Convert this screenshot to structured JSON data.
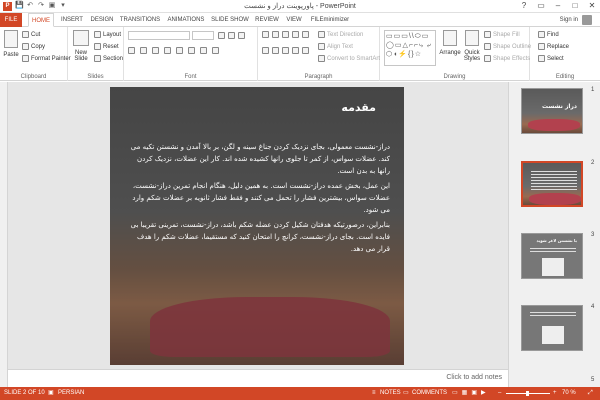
{
  "app": {
    "logo": "P",
    "title": "پاورپوینت دراز و نشست - PowerPoint",
    "window_buttons": [
      "?",
      "▭",
      "–",
      "□",
      "✕"
    ]
  },
  "qat": [
    "💾",
    "↶",
    "↷",
    "▣",
    "▾"
  ],
  "tabs": [
    "FILE",
    "HOME",
    "INSERT",
    "DESIGN",
    "TRANSITIONS",
    "ANIMATIONS",
    "SLIDE SHOW",
    "REVIEW",
    "VIEW",
    "FILEminimizer"
  ],
  "signin": "Sign in",
  "ribbon": {
    "clipboard": {
      "label": "Clipboard",
      "paste": "Paste",
      "cut": "Cut",
      "copy": "Copy",
      "format_painter": "Format Painter"
    },
    "slides": {
      "label": "Slides",
      "new_slide": "New Slide",
      "layout": "Layout",
      "reset": "Reset",
      "section": "Section"
    },
    "font": {
      "label": "Font"
    },
    "paragraph": {
      "label": "Paragraph",
      "text_direction": "Text Direction",
      "align_text": "Align Text",
      "convert_smartart": "Convert to SmartArt"
    },
    "drawing": {
      "label": "Drawing",
      "arrange": "Arrange",
      "quick_styles": "Quick Styles",
      "shape_fill": "Shape Fill",
      "shape_outline": "Shape Outline",
      "shape_effects": "Shape Effects",
      "shapes_glyphs": "▭▭▭\\\\⬭▭ ◯▭△⌐⌐⤷ ⤶ ⬡◖⚡{}☆"
    },
    "editing": {
      "label": "Editing",
      "find": "Find",
      "replace": "Replace",
      "select": "Select"
    }
  },
  "slide": {
    "title": "مقدمه",
    "paragraphs": [
      "دراز-نشست معمولی، بجای نزدیک کردن جناغ سینه و لگن، بر بالا آمدن و نشستن تکیه می کند. عضلات سواس، از کمر تا جلوی رانها کشیده شده اند. کار این عضلات، نزدیک کردن رانها به بدن است.",
      "این عمل، بخش عمده دراز-نشست است. به همین دلیل، هنگام انجام تمرین دراز-نشست، عضلات سواس، بیشترین فشار را تحمل می کنند و فقط فشار ثانویه بر عضلات شکم وارد می شود.",
      "بنابراین، درصورتیکه هدفتان شکیل کردن عضله شکم باشد، دراز-نشست، تمرینی تقریبا بی فایده است. بجای دراز-نشست، کرانچ را امتحان کنید که مستقیما، عضلات شکم را هدف قرار می دهد."
    ]
  },
  "thumbnails": [
    {
      "num": "1",
      "title": "دراز نشست"
    },
    {
      "num": "2",
      "title": ""
    },
    {
      "num": "3",
      "title": "با نشستن لاغر شوید"
    },
    {
      "num": "4",
      "title": ""
    },
    {
      "num": "5",
      "title": ""
    }
  ],
  "notes_placeholder": "Click to add notes",
  "status": {
    "slide": "SLIDE 2 OF 10",
    "language": "PERSIAN",
    "notes": "NOTES",
    "comments": "COMMENTS",
    "zoom": "70 %"
  }
}
